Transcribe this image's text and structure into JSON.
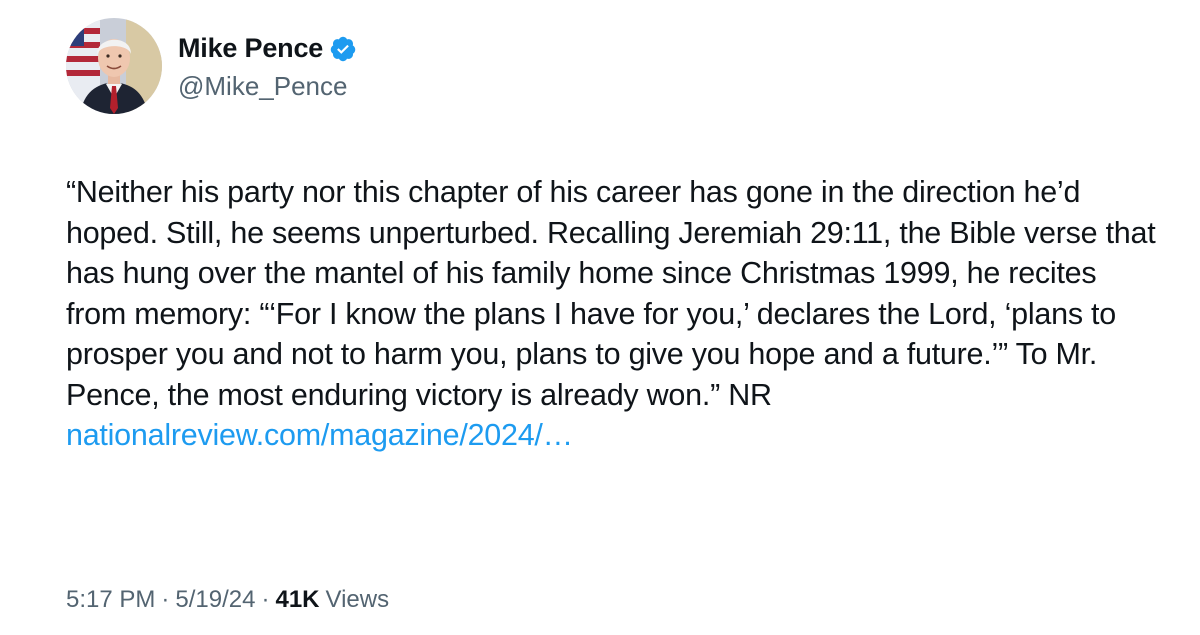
{
  "author": {
    "display_name": "Mike Pence",
    "handle": "@Mike_Pence",
    "verified": true,
    "avatar_icon": "profile-photo"
  },
  "tweet": {
    "text": "“Neither his party nor this chapter of his career has gone in the direction he’d hoped. Still, he seems unperturbed. Recalling Jeremiah 29:11, the Bible verse that has hung over the mantel of his family home since Christmas 1999, he recites from memory: “‘For I know the plans I have for you,’ declares the Lord, ‘plans to prosper you and not to harm you, plans to give you hope and a future.’” To Mr. Pence, the most enduring victory is already won.” NR ",
    "link_text": "nationalreview.com/magazine/2024/…"
  },
  "meta": {
    "time": "5:17 PM",
    "date": "5/19/24",
    "separator": "·",
    "views_count": "41K",
    "views_label": "Views"
  },
  "colors": {
    "link": "#1d9bf0",
    "verified_badge": "#1d9bf0",
    "text_primary": "#0f1419",
    "text_secondary": "#536471"
  }
}
